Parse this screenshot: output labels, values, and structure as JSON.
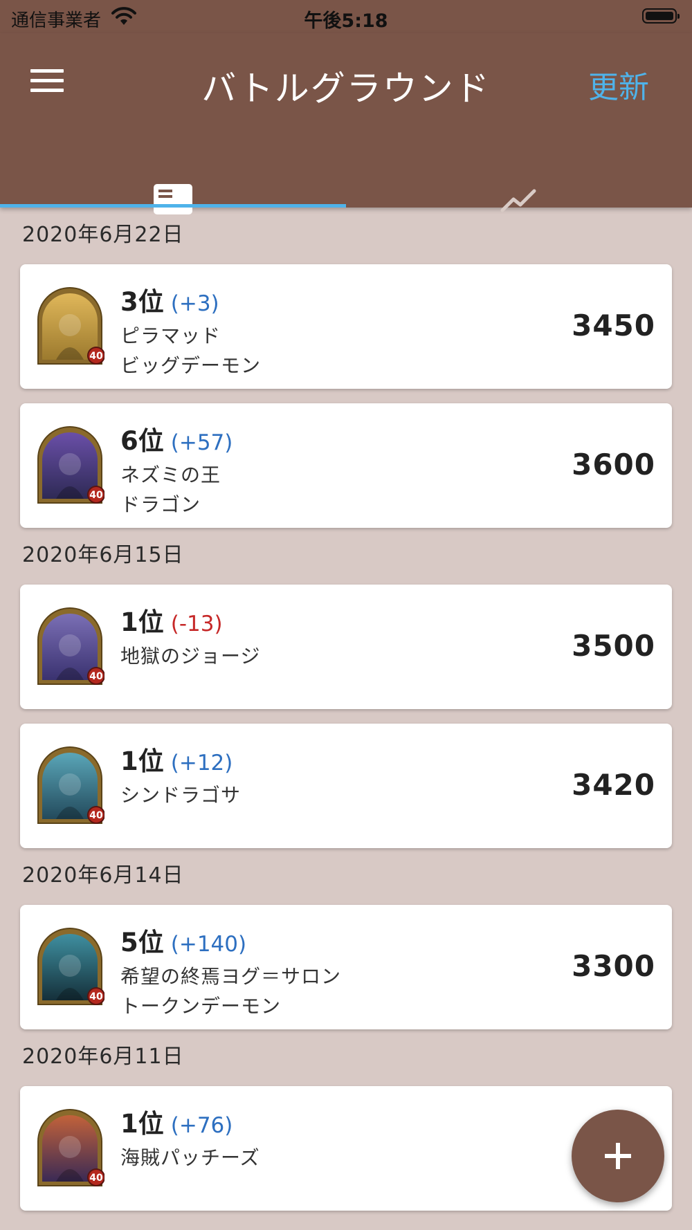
{
  "status_bar": {
    "carrier": "通信事業者",
    "time": "午後5:18"
  },
  "app_bar": {
    "title": "バトルグラウンド",
    "refresh_label": "更新",
    "tabs": [
      {
        "icon": "card-list-icon",
        "selected": true
      },
      {
        "icon": "trend-chart-icon",
        "selected": false
      }
    ]
  },
  "colors": {
    "app_bar": "#7a5548",
    "background": "#d8c9c5",
    "accent": "#4fb3ea",
    "positive": "#2d6fc0",
    "negative": "#c62828"
  },
  "groups": [
    {
      "date": "2020年6月22日",
      "matches": [
        {
          "rank": "3位",
          "delta": "(+3)",
          "delta_type": "pos",
          "hero": "ピラマッド",
          "tribe": "ビッグデーモン",
          "mmr": "3450",
          "level": "40",
          "portrait_colors": [
            "#e0b75a",
            "#9c7a2e"
          ]
        },
        {
          "rank": "6位",
          "delta": "(+57)",
          "delta_type": "pos",
          "hero": "ネズミの王",
          "tribe": "ドラゴン",
          "mmr": "3600",
          "level": "40",
          "portrait_colors": [
            "#6a4fa8",
            "#2e2a55"
          ]
        }
      ]
    },
    {
      "date": "2020年6月15日",
      "matches": [
        {
          "rank": "1位",
          "delta": "(-13)",
          "delta_type": "neg",
          "hero": "地獄のジョージ",
          "tribe": "",
          "mmr": "3500",
          "level": "40",
          "portrait_colors": [
            "#7b6fb5",
            "#3a3270"
          ]
        },
        {
          "rank": "1位",
          "delta": "(+12)",
          "delta_type": "pos",
          "hero": "シンドラゴサ",
          "tribe": "",
          "mmr": "3420",
          "level": "40",
          "portrait_colors": [
            "#5aa6b8",
            "#234a5c"
          ]
        }
      ]
    },
    {
      "date": "2020年6月14日",
      "matches": [
        {
          "rank": "5位",
          "delta": "(+140)",
          "delta_type": "pos",
          "hero": "希望の終焉ヨグ＝サロン",
          "tribe": "トークンデーモン",
          "mmr": "3300",
          "level": "40",
          "portrait_colors": [
            "#3f8fa0",
            "#15303a"
          ]
        }
      ]
    },
    {
      "date": "2020年6月11日",
      "matches": [
        {
          "rank": "1位",
          "delta": "(+76)",
          "delta_type": "pos",
          "hero": "海賊パッチーズ",
          "tribe": "",
          "mmr": "",
          "level": "40",
          "portrait_colors": [
            "#c2623a",
            "#3a2a55"
          ]
        }
      ]
    }
  ],
  "fab": {
    "icon": "plus-icon"
  }
}
